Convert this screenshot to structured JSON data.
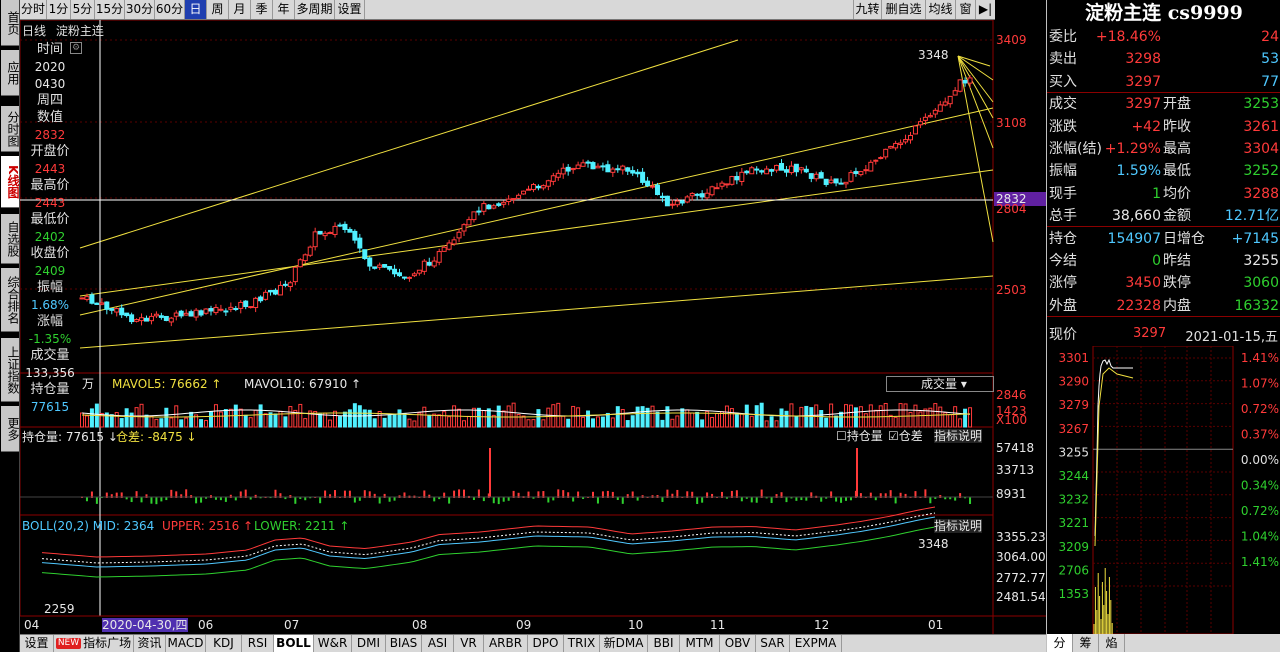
{
  "sidebar": {
    "tabs": [
      "首页",
      "应用",
      "分时图",
      "K线图",
      "自选股",
      "综合排名",
      "上证指数",
      "更多"
    ]
  },
  "topbar": {
    "periods": [
      "分时",
      "1分",
      "5分",
      "15分",
      "30分",
      "60分",
      "日",
      "周",
      "月",
      "季",
      "年",
      "多周期",
      "设置"
    ],
    "active_period": "日",
    "right_buttons": [
      "九转",
      "删自选",
      "均线",
      "窗",
      "▶|"
    ]
  },
  "chart_header": {
    "period_label": "日线",
    "name": "淀粉主连"
  },
  "info_box": {
    "items": [
      {
        "label": "时间",
        "value": "2020",
        "value2": "0430",
        "cls": "white"
      },
      {
        "label": "周四",
        "value": "",
        "value2": "",
        "cls": "white"
      },
      {
        "label": "数值",
        "value": "2832",
        "value2": "",
        "cls": "red"
      },
      {
        "label": "开盘价",
        "value": "2443",
        "value2": "",
        "cls": "red"
      },
      {
        "label": "最高价",
        "value": "2443",
        "value2": "",
        "cls": "red"
      },
      {
        "label": "最低价",
        "value": "2402",
        "value2": "",
        "cls": "green"
      },
      {
        "label": "收盘价",
        "value": "2409",
        "value2": "",
        "cls": "green"
      },
      {
        "label": "振幅",
        "value": "1.68%",
        "value2": "",
        "cls": "cyan"
      },
      {
        "label": "涨幅",
        "value": "-1.35%",
        "value2": "",
        "cls": "green"
      },
      {
        "label": "成交量",
        "value": "133,356",
        "value2": "",
        "cls": "white"
      },
      {
        "label": "持仓量",
        "value": "77615",
        "value2": "",
        "cls": "cyan"
      }
    ]
  },
  "price_axis": {
    "labels": [
      "3409",
      "3108",
      "2832",
      "2804",
      "2503"
    ],
    "current_highlight": "2832",
    "peak_label": "3348"
  },
  "volume_panel": {
    "unit": "万",
    "mavol5": "MAVOL5: 76662",
    "mavol10": "MAVOL10: 67910",
    "dropdown": "成交量",
    "axis": [
      "2846",
      "1423",
      "X100"
    ]
  },
  "oi_panel": {
    "oi_label": "持仓量: 77615",
    "diff_label": "仓差: -8475",
    "check_oi": "持仓量",
    "check_diff": "仓差",
    "explain": "指标说明",
    "axis": [
      "57418",
      "33713",
      "8931"
    ]
  },
  "boll_panel": {
    "mid": "BOLL(20,2) MID: 2364",
    "upper": "UPPER: 2516",
    "lower": "LOWER: 2211",
    "explain": "指标说明",
    "peak": "3348",
    "low": "2259",
    "axis": [
      "3355.23",
      "3064.00",
      "2772.77",
      "2481.54"
    ]
  },
  "x_axis": {
    "months": [
      "04",
      "06",
      "07",
      "08",
      "09",
      "10",
      "11",
      "12",
      "01"
    ],
    "cursor_date": "2020-04-30,四"
  },
  "bottombar": {
    "items": [
      "设置",
      "指标广场",
      "资讯",
      "MACD",
      "KDJ",
      "RSI",
      "BOLL",
      "W&R",
      "DMI",
      "BIAS",
      "ASI",
      "VR",
      "ARBR",
      "DPO",
      "TRIX",
      "新DMA",
      "BBI",
      "MTM",
      "OBV",
      "SAR",
      "EXPMA"
    ],
    "new_badge": "NEW",
    "active": "BOLL"
  },
  "quote_panel": {
    "title": "淀粉主连 cs9999",
    "rows": [
      {
        "k": "委比",
        "v": "+18.46%",
        "vc": "red",
        "k2": "",
        "v2": "24",
        "v2c": "red"
      },
      {
        "k": "卖出",
        "v": "3298",
        "vc": "red",
        "k2": "",
        "v2": "53",
        "v2c": "cyan"
      },
      {
        "k": "买入",
        "v": "3297",
        "vc": "red",
        "k2": "",
        "v2": "77",
        "v2c": "cyan"
      },
      {
        "k": "成交",
        "v": "3297",
        "vc": "red",
        "k2": "开盘",
        "v2": "3253",
        "v2c": "green"
      },
      {
        "k": "涨跌",
        "v": "+42",
        "vc": "red",
        "k2": "昨收",
        "v2": "3261",
        "v2c": "red"
      },
      {
        "k": "涨幅(结)",
        "v": "+1.29%",
        "vc": "red",
        "k2": "最高",
        "v2": "3304",
        "v2c": "red"
      },
      {
        "k": "振幅",
        "v": "1.59%",
        "vc": "cyan",
        "k2": "最低",
        "v2": "3252",
        "v2c": "green"
      },
      {
        "k": "现手",
        "v": "1",
        "vc": "green",
        "k2": "均价",
        "v2": "3288",
        "v2c": "red"
      },
      {
        "k": "总手",
        "v": "38,660",
        "vc": "white",
        "k2": "金额",
        "v2": "12.71亿",
        "v2c": "cyan"
      },
      {
        "k": "持仓",
        "v": "154907",
        "vc": "cyan",
        "k2": "日增仓",
        "v2": "+7145",
        "v2c": "cyan"
      },
      {
        "k": "今结",
        "v": "0",
        "vc": "green",
        "k2": "昨结",
        "v2": "3255",
        "v2c": "white"
      },
      {
        "k": "涨停",
        "v": "3450",
        "vc": "red",
        "k2": "跌停",
        "v2": "3060",
        "v2c": "green"
      },
      {
        "k": "外盘",
        "v": "22328",
        "vc": "red",
        "k2": "内盘",
        "v2": "16332",
        "v2c": "green"
      }
    ],
    "now_label": "现价",
    "now_value": "3297",
    "date": "2021-01-15,五"
  },
  "mini_chart": {
    "left_axis": [
      "3301",
      "3290",
      "3279",
      "3267",
      "3255",
      "3244",
      "3232",
      "3221",
      "3209",
      "2706",
      "1353"
    ],
    "right_axis": [
      "1.41%",
      "1.07%",
      "0.72%",
      "0.37%",
      "0.00%",
      "0.34%",
      "0.72%",
      "1.04%",
      "1.41%"
    ],
    "tabs": [
      "分",
      "筹",
      "焰"
    ]
  }
}
